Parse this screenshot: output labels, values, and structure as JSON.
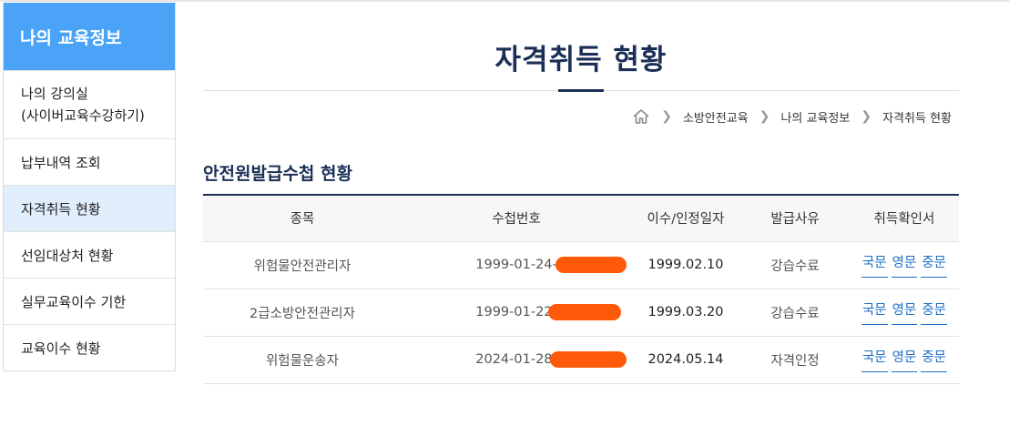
{
  "sidebar": {
    "title": "나의 교육정보",
    "items": [
      {
        "line1": "나의 강의실",
        "line2": "(사이버교육수강하기)"
      },
      {
        "label": "납부내역 조회"
      },
      {
        "label": "자격취득 현황"
      },
      {
        "label": "선임대상처 현황"
      },
      {
        "label": "실무교육이수 기한"
      },
      {
        "label": "교육이수 현황"
      }
    ],
    "active_index": 2
  },
  "page": {
    "title": "자격취득 현황"
  },
  "breadcrumb": {
    "home_icon": "home-icon",
    "items": [
      "소방안전교육",
      "나의 교육정보",
      "자격취득 현황"
    ]
  },
  "section": {
    "title": "안전원발급수첩 현황"
  },
  "table": {
    "headers": [
      "종목",
      "수첩번호",
      "이수/인정일자",
      "발급사유",
      "취득확인서"
    ],
    "rows": [
      {
        "item": "위험물안전관리자",
        "number": "1999-01-24-",
        "date": "1999.02.10",
        "reason": "강습수료",
        "links": [
          "국문",
          "영문",
          "중문"
        ]
      },
      {
        "item": "2급소방안전관리자",
        "number": "1999-01-22-",
        "date": "1999.03.20",
        "reason": "강습수료",
        "links": [
          "국문",
          "영문",
          "중문"
        ]
      },
      {
        "item": "위험물운송자",
        "number": "2024-01-28-",
        "date": "2024.05.14",
        "reason": "자격인정",
        "links": [
          "국문",
          "영문",
          "중문"
        ]
      }
    ]
  },
  "colors": {
    "sidebar_header": "#4aa3f7",
    "active_item": "#e0eefc",
    "title_navy": "#1a2f55",
    "link_blue": "#1f6fc6",
    "redaction": "#ff5a0a"
  }
}
